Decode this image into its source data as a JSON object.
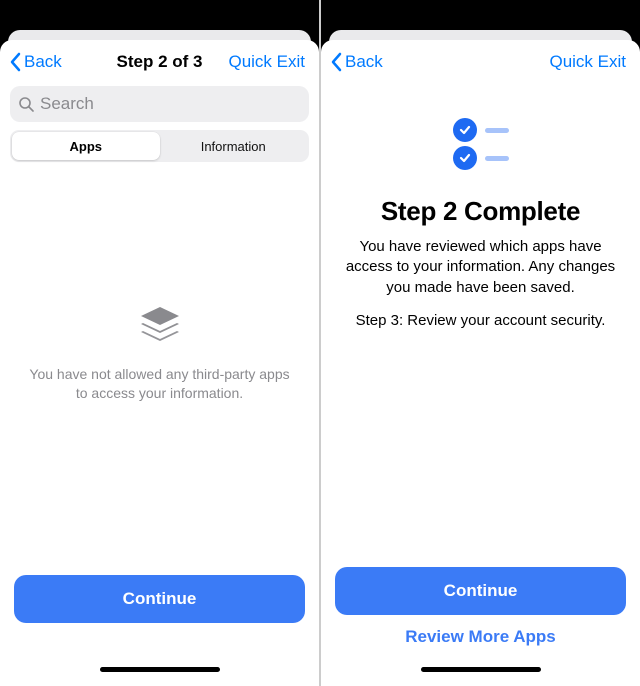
{
  "left": {
    "nav": {
      "back_label": "Back",
      "title": "Step 2 of 3",
      "exit_label": "Quick Exit"
    },
    "search": {
      "placeholder": "Search"
    },
    "segments": {
      "apps": "Apps",
      "information": "Information"
    },
    "empty": {
      "message": "You have not allowed any third-party apps to access your information."
    },
    "footer": {
      "continue": "Continue"
    }
  },
  "right": {
    "nav": {
      "back_label": "Back",
      "exit_label": "Quick Exit"
    },
    "completion": {
      "title": "Step 2 Complete",
      "body": "You have reviewed which apps have access to your information. Any changes you made have been saved.",
      "next": "Step 3: Review your account security."
    },
    "footer": {
      "continue": "Continue",
      "review_more": "Review More Apps"
    }
  }
}
